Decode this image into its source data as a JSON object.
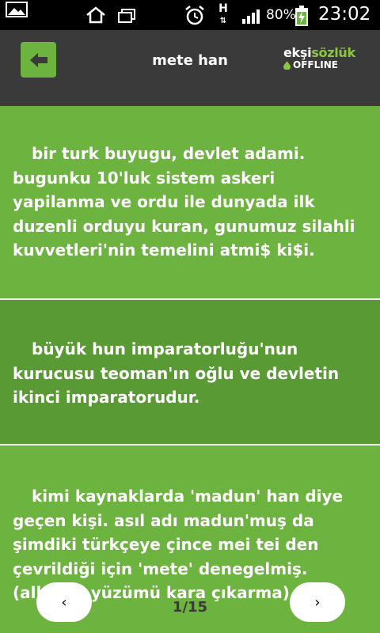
{
  "status_bar": {
    "battery_percent": "80%",
    "time": "23:02",
    "network_type": "H"
  },
  "header": {
    "title": "mete han",
    "logo": {
      "brand_part1": "ekşi",
      "brand_part2": "sözlük",
      "subtitle": "OFFLINE"
    }
  },
  "entries": [
    {
      "text": "bir turk buyugu, devlet adami. bugunku 10'luk sistem askeri yapilanma ve ordu ile dunyada ilk duzenli orduyu kuran, gunumuz silahli kuvvetleri'nin temelini atmi$ ki$i."
    },
    {
      "text": "büyük hun imparatorluğu'nun kurucusu teoman'ın oğlu ve devletin ikinci imparatorudur."
    },
    {
      "text": "kimi kaynaklarda 'madun' han diye geçen kişi. asıl adı madun'muş da şimdiki türkçeye çince mei tei den çevrildiği için 'mete' denegelmiş. (allahım yüzümü kara çıkarma)"
    }
  ],
  "pager": {
    "prev_label": "‹",
    "next_label": "›",
    "indicator": "1/15"
  },
  "colors": {
    "accent_green": "#6db33f",
    "dark_green": "#5a9a35",
    "header_bg": "#3a3a3a"
  }
}
